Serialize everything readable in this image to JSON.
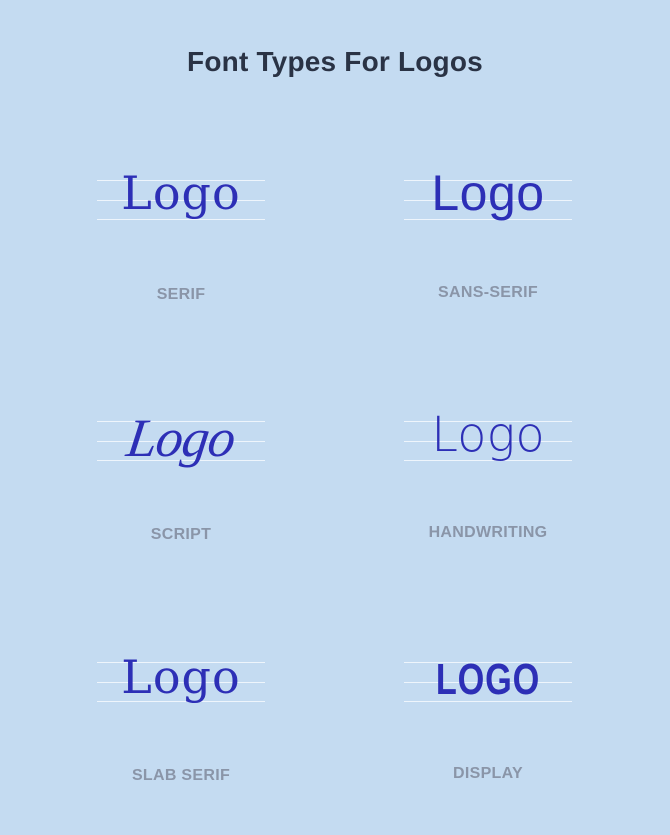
{
  "title": "Font Types For Logos",
  "colors": {
    "background": "#c4dbf1",
    "logo": "#2d2fb6",
    "label": "#8a95a8",
    "title": "#2a3345"
  },
  "samples": [
    {
      "word": "Logo",
      "label": "SERIF"
    },
    {
      "word": "Logo",
      "label": "SANS-SERIF"
    },
    {
      "word": "Logo",
      "label": "SCRIPT"
    },
    {
      "word": "Logo",
      "label": "HANDWRITING"
    },
    {
      "word": "Logo",
      "label": "SLAB SERIF"
    },
    {
      "word": "LOGO",
      "label": "DISPLAY"
    }
  ]
}
